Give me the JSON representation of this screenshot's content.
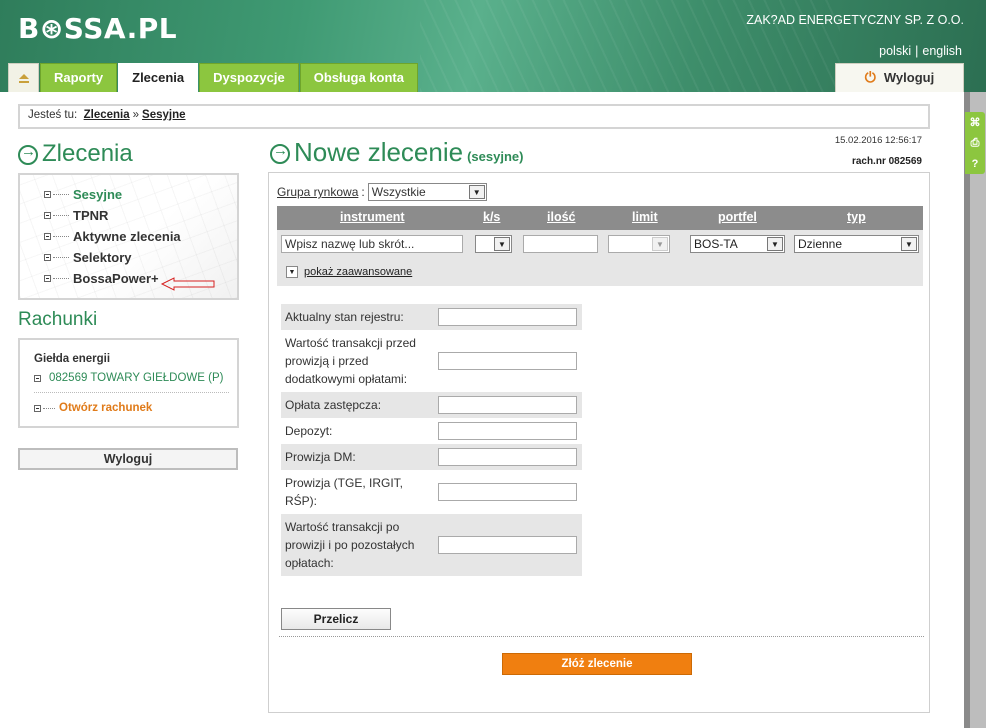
{
  "header": {
    "logo": "B⊛SSA.PL",
    "company": "ZAK?AD ENERGETYCZNY SP. Z O.O.",
    "lang_pl": "polski",
    "lang_sep": "|",
    "lang_en": "english"
  },
  "tabs": [
    {
      "label": "Raporty"
    },
    {
      "label": "Zlecenia"
    },
    {
      "label": "Dyspozycje"
    },
    {
      "label": "Obsługa konta"
    }
  ],
  "header_logout": "Wyloguj",
  "breadcrumb": {
    "prefix": "Jesteś tu:",
    "item1": "Zlecenia",
    "sep": "»",
    "item2": "Sesyjne"
  },
  "left": {
    "title": "Zlecenia",
    "menu": [
      "Sesyjne",
      "TPNR",
      "Aktywne zlecenia",
      "Selektory",
      "BossaPower+"
    ],
    "accounts_title": "Rachunki",
    "group": "Giełda energii",
    "account": "082569 TOWARY GIEŁDOWE (P)",
    "open_account": "Otwórz rachunek",
    "logout": "Wyloguj"
  },
  "main": {
    "title": "Nowe zlecenie",
    "subtitle": "(sesyjne)",
    "datetime": "15.02.2016 12:56:17",
    "account_nr": "rach.nr 082569",
    "grupa_label": "Grupa rynkowa",
    "grupa_value": "Wszystkie",
    "columns": [
      "instrument",
      "k/s",
      "ilość",
      "limit",
      "portfel",
      "typ"
    ],
    "instrument_placeholder": "Wpisz nazwę lub skrót...",
    "portfel_value": "BOS-TA",
    "typ_value": "Dzienne",
    "advanced": "pokaż zaawansowane",
    "calc_rows": [
      "Aktualny stan rejestru:",
      "Wartość transakcji przed prowizją i przed dodatkowymi opłatami:",
      "Opłata zastępcza:",
      "Depozyt:",
      "Prowizja DM:",
      "Prowizja (TGE, IRGIT, RŚP):",
      "Wartość transakcji po prowizji i po pozostałych opłatach:"
    ],
    "btn_przelicz": "Przelicz",
    "btn_submit": "Złóż zlecenie"
  },
  "colors": {
    "green": "#8cc63f",
    "dark_green": "#2e8b57",
    "orange": "#f07f10"
  }
}
